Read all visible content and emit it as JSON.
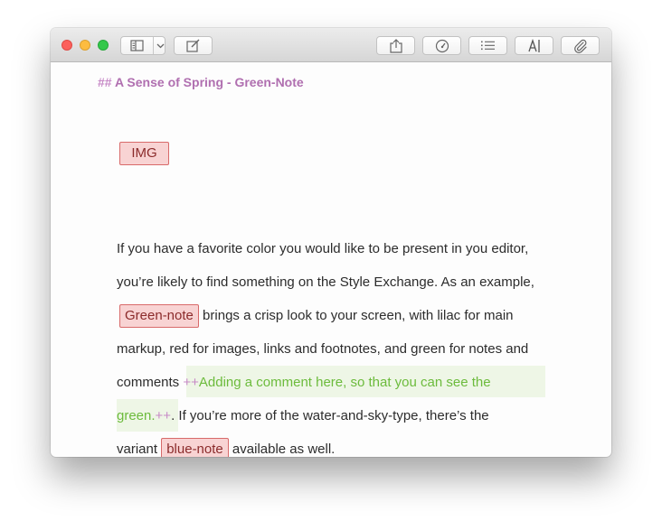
{
  "window": {
    "traffic_lights": [
      "close",
      "minimize",
      "zoom"
    ]
  },
  "toolbar": {
    "left": [
      {
        "name": "sidebar-toggle",
        "icon": "sidebar-icon"
      },
      {
        "name": "compose",
        "icon": "compose-icon"
      }
    ],
    "right": [
      {
        "name": "share",
        "icon": "share-icon"
      },
      {
        "name": "preview",
        "icon": "gauge-icon"
      },
      {
        "name": "outline",
        "icon": "list-icon"
      },
      {
        "name": "typography",
        "icon": "text-cursor-icon"
      },
      {
        "name": "attach",
        "icon": "paperclip-icon"
      }
    ]
  },
  "document": {
    "heading_marker": "##",
    "heading_text": "A Sense of Spring - Green-Note",
    "img_tag": "IMG",
    "lines": {
      "l1": "If you have a favorite color you would like to be present in you editor,",
      "l2": "you’re likely to find something on the Style Exchange. As an example,",
      "l3_tag": "Green-note",
      "l3_text": " brings a crisp look to your screen, with lilac for main",
      "l4": "markup, red for images, links and footnotes, and green for notes  and",
      "l5_pre": "comments ",
      "l5_plus": "++",
      "l5_comment": "Adding a comment here, so that you can see the",
      "l6_comment": "green.",
      "l6_plus": "++",
      "l6_text": ". If you’re more of the water-and-sky-type, there’s the",
      "l7_pre": "variant ",
      "l7_tag": "blue-note",
      "l7_text": " available as well."
    }
  },
  "colors": {
    "markup": "#b06fb0",
    "tag_bg": "#f8d3d3",
    "tag_border": "#d86a6a",
    "comment_text": "#6cbb3c",
    "comment_bg": "#eef6e6"
  }
}
